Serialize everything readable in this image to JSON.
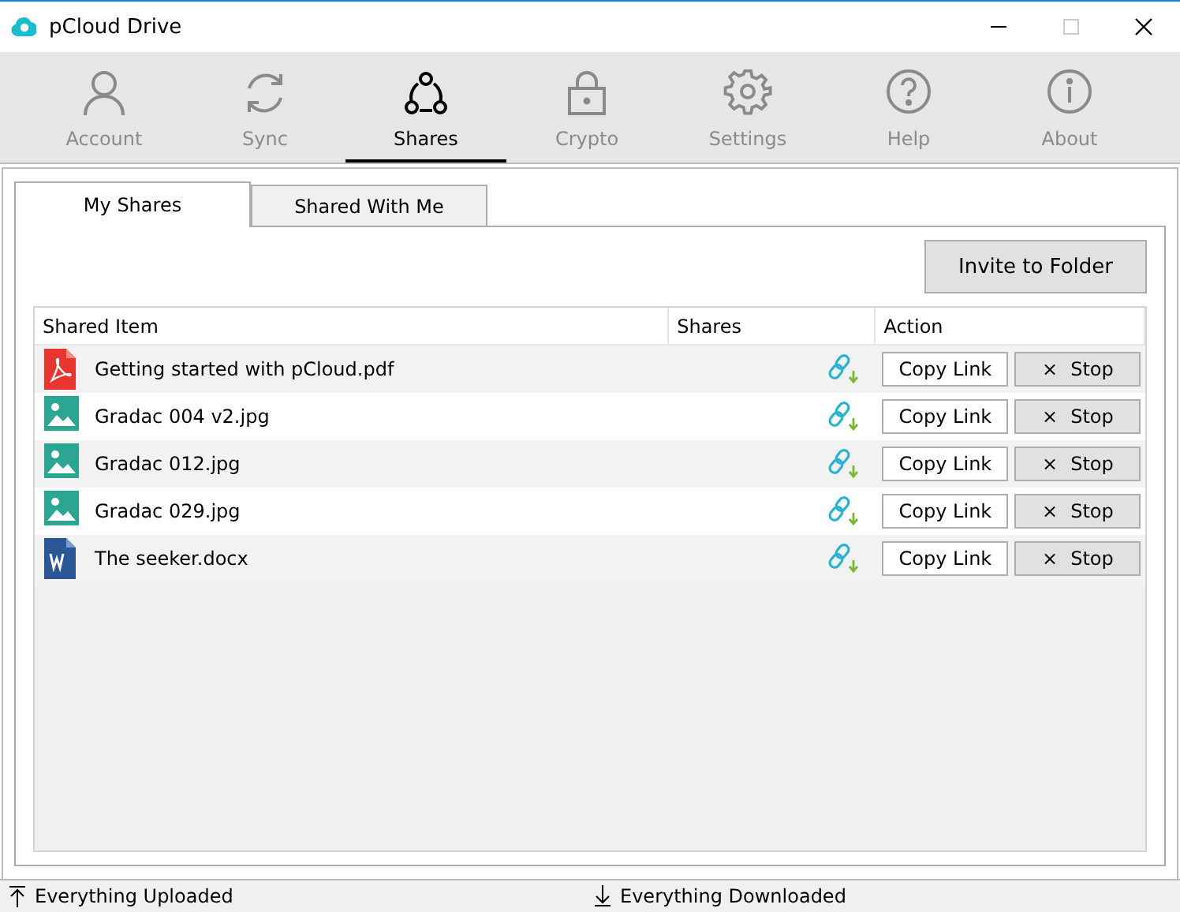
{
  "window": {
    "title": "pCloud Drive"
  },
  "nav": [
    {
      "label": "Account",
      "kind": "person",
      "selected": false
    },
    {
      "label": "Sync",
      "kind": "sync",
      "selected": false
    },
    {
      "label": "Shares",
      "kind": "share",
      "selected": true
    },
    {
      "label": "Crypto",
      "kind": "lock",
      "selected": false
    },
    {
      "label": "Settings",
      "kind": "gear",
      "selected": false
    },
    {
      "label": "Help",
      "kind": "help",
      "selected": false
    },
    {
      "label": "About",
      "kind": "info",
      "selected": false
    }
  ],
  "tabs": [
    {
      "label": "My Shares",
      "selected": true
    },
    {
      "label": "Shared With Me",
      "selected": false
    }
  ],
  "invite_button": "Invite to Folder",
  "table": {
    "columns": [
      "Shared Item",
      "Shares",
      "Action"
    ],
    "rows": [
      {
        "kind": "pdf",
        "name": "Getting started with pCloud.pdf",
        "copy": "Copy Link",
        "stop": "Stop",
        "stop_icon": "×"
      },
      {
        "kind": "image",
        "name": "Gradac 004 v2.jpg",
        "copy": "Copy Link",
        "stop": "Stop",
        "stop_icon": "×"
      },
      {
        "kind": "image",
        "name": "Gradac 012.jpg",
        "copy": "Copy Link",
        "stop": "Stop",
        "stop_icon": "×"
      },
      {
        "kind": "image",
        "name": "Gradac 029.jpg",
        "copy": "Copy Link",
        "stop": "Stop",
        "stop_icon": "×"
      },
      {
        "kind": "word",
        "name": "The seeker.docx",
        "copy": "Copy Link",
        "stop": "Stop",
        "stop_icon": "×"
      }
    ]
  },
  "status_bar": {
    "upload": "Everything Uploaded",
    "download": "Everything Downloaded"
  }
}
